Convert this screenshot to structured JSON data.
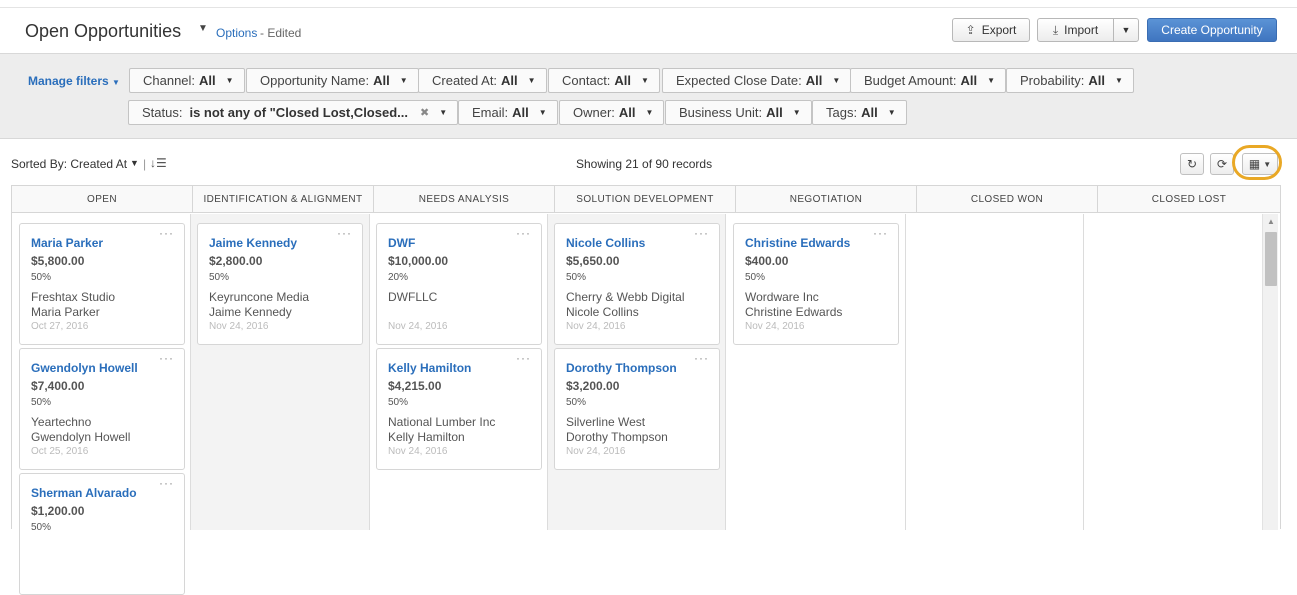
{
  "header": {
    "title": "Open Opportunities",
    "options_label": "Options",
    "edited_label": "- Edited",
    "export_label": "Export",
    "import_label": "Import",
    "create_label": "Create Opportunity"
  },
  "filters": {
    "manage_label": "Manage filters",
    "chips": [
      {
        "label": "Channel:",
        "value": "All"
      },
      {
        "label": "Opportunity Name:",
        "value": "All"
      },
      {
        "label": "Created At:",
        "value": "All"
      },
      {
        "label": "Contact:",
        "value": "All"
      },
      {
        "label": "Expected Close Date:",
        "value": "All"
      },
      {
        "label": "Budget Amount:",
        "value": "All"
      },
      {
        "label": "Probability:",
        "value": "All"
      },
      {
        "label": "Status:",
        "value": "is not any of \"Closed Lost,Closed..."
      },
      {
        "label": "Email:",
        "value": "All"
      },
      {
        "label": "Owner:",
        "value": "All"
      },
      {
        "label": "Business Unit:",
        "value": "All"
      },
      {
        "label": "Tags:",
        "value": "All"
      }
    ]
  },
  "toolbar": {
    "sorted_label": "Sorted By: Created At",
    "showing_label": "Showing 21 of 90 records"
  },
  "board": {
    "columns": [
      {
        "title": "OPEN"
      },
      {
        "title": "IDENTIFICATION & ALIGNMENT"
      },
      {
        "title": "NEEDS ANALYSIS"
      },
      {
        "title": "SOLUTION DEVELOPMENT"
      },
      {
        "title": "NEGOTIATION"
      },
      {
        "title": "CLOSED WON"
      },
      {
        "title": "CLOSED LOST"
      }
    ],
    "cards": [
      {
        "name": "Maria Parker",
        "amount": "$5,800.00",
        "probability": "50%",
        "company": "Freshtax Studio",
        "contact": "Maria Parker",
        "date": "Oct 27, 2016"
      },
      {
        "name": "Gwendolyn Howell",
        "amount": "$7,400.00",
        "probability": "50%",
        "company": "Yeartechno",
        "contact": "Gwendolyn Howell",
        "date": "Oct 25, 2016"
      },
      {
        "name": "Sherman Alvarado",
        "amount": "$1,200.00",
        "probability": "50%",
        "company": "",
        "contact": "",
        "date": ""
      },
      {
        "name": "Jaime Kennedy",
        "amount": "$2,800.00",
        "probability": "50%",
        "company": "Keyruncone Media",
        "contact": "Jaime Kennedy",
        "date": "Nov 24, 2016"
      },
      {
        "name": "DWF",
        "amount": "$10,000.00",
        "probability": "20%",
        "company": "DWFLLC",
        "contact": "",
        "date": "Nov 24, 2016"
      },
      {
        "name": "Kelly Hamilton",
        "amount": "$4,215.00",
        "probability": "50%",
        "company": "National Lumber Inc",
        "contact": "Kelly Hamilton",
        "date": "Nov 24, 2016"
      },
      {
        "name": "Nicole Collins",
        "amount": "$5,650.00",
        "probability": "50%",
        "company": "Cherry & Webb Digital",
        "contact": "Nicole Collins",
        "date": "Nov 24, 2016"
      },
      {
        "name": "Dorothy Thompson",
        "amount": "$3,200.00",
        "probability": "50%",
        "company": "Silverline West",
        "contact": "Dorothy Thompson",
        "date": "Nov 24, 2016"
      },
      {
        "name": "Christine Edwards",
        "amount": "$400.00",
        "probability": "50%",
        "company": "Wordware Inc",
        "contact": "Christine Edwards",
        "date": "Nov 24, 2016"
      }
    ]
  },
  "icons": {
    "export": "upload-icon",
    "import": "download-icon",
    "refresh": "refresh-icon",
    "sync": "sync-icon",
    "grid": "grid-view-icon",
    "sort": "sort-icon"
  },
  "colors": {
    "link": "#2a6ebb",
    "primary_button": "#3f75c0",
    "highlight_ring": "#e9a825"
  }
}
